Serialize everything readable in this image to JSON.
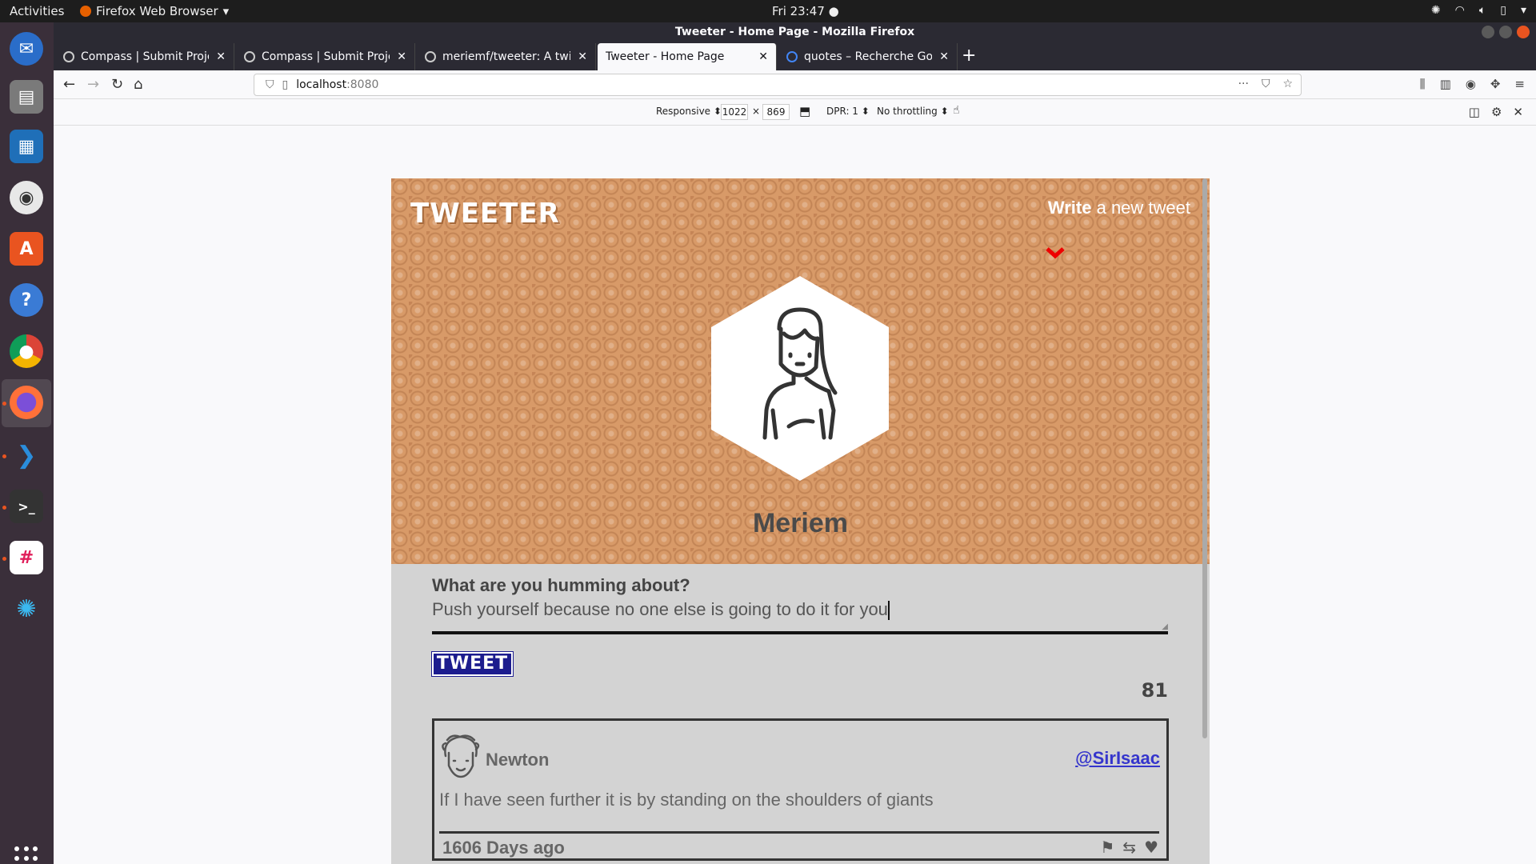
{
  "topbar": {
    "activities": "Activities",
    "app_menu": "Firefox Web Browser",
    "clock": "Fri 23:47 ●"
  },
  "window": {
    "title": "Tweeter - Home Page - Mozilla Firefox"
  },
  "tabs": [
    {
      "label": "Compass | Submit Project"
    },
    {
      "label": "Compass | Submit Project"
    },
    {
      "label": "meriemf/tweeter: A twitter"
    },
    {
      "label": "Tweeter - Home Page"
    },
    {
      "label": "quotes – Recherche Google"
    }
  ],
  "url": {
    "host": "localhost",
    "port": ":8080"
  },
  "rdm": {
    "device": "Responsive ⬍",
    "width": "1022",
    "x": "×",
    "height": "869",
    "dpr": "DPR: 1 ⬍",
    "throttling": "No throttling ⬍"
  },
  "site": {
    "brand": "TWEETER",
    "write_bold": "Write",
    "write_rest": " a new tweet",
    "username": "Meriem",
    "composer_prompt": "What are you humming about?",
    "composer_text": "Push yourself because no one else is going to do it for you",
    "tweet_button": "TWEET",
    "char_count": "81"
  },
  "tweet": {
    "name": "Newton",
    "handle": "@SirIsaac",
    "body": "If I have seen further it is by standing on the shoulders of giants",
    "age": "1606 Days ago"
  },
  "colors": {
    "header_bg": "#d89a68",
    "tweet_button_bg": "#1c1c8e",
    "handle": "#3535cc",
    "chevron": "#e00000"
  }
}
